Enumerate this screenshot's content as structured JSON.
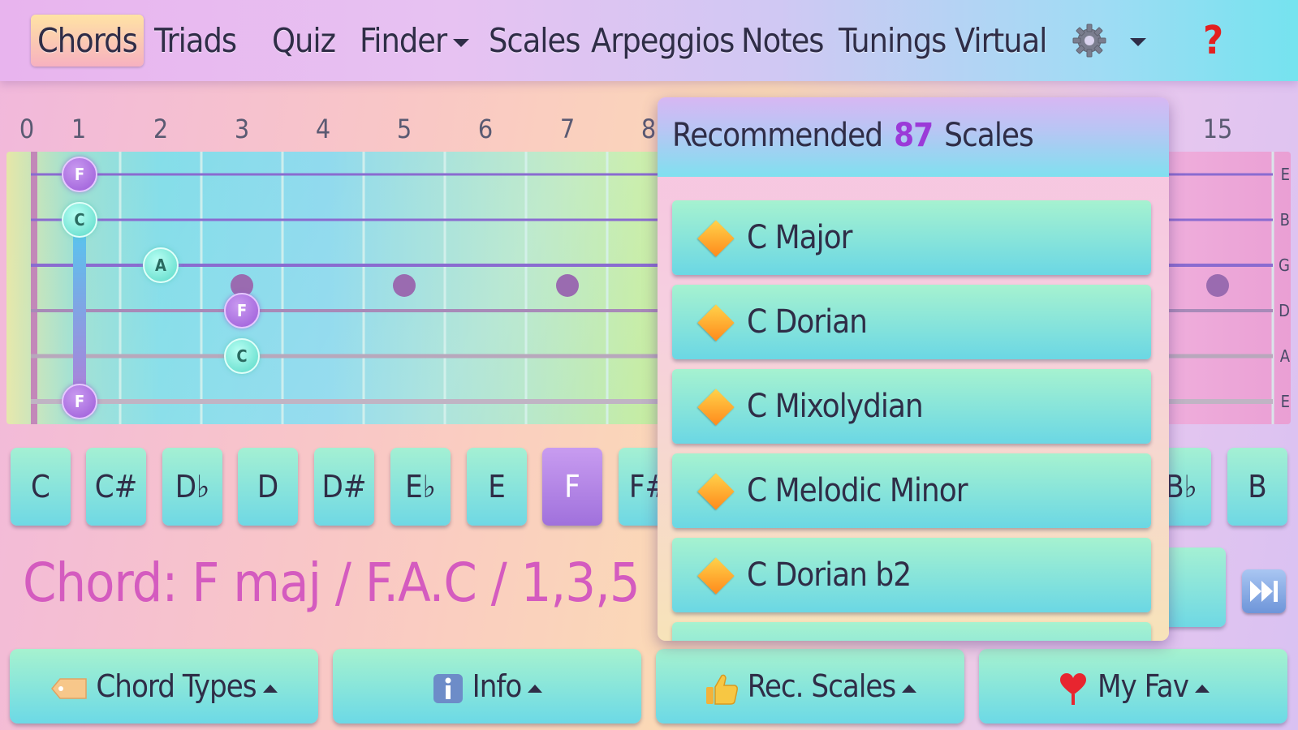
{
  "nav": {
    "items": [
      {
        "label": "Chords",
        "active": true
      },
      {
        "label": "Triads"
      },
      {
        "label": "Quiz"
      },
      {
        "label": "Finder"
      },
      {
        "label": "Scales"
      },
      {
        "label": "Arpeggios"
      },
      {
        "label": "Notes"
      },
      {
        "label": "Tunings"
      },
      {
        "label": "Virtual"
      }
    ],
    "help_label": "?",
    "settings_icon": "gear-icon"
  },
  "fretboard": {
    "fret_numbers": [
      "0",
      "1",
      "2",
      "3",
      "4",
      "5",
      "6",
      "7",
      "8",
      "15"
    ],
    "string_labels": [
      "E",
      "B",
      "G",
      "D",
      "A",
      "E"
    ],
    "notes": [
      {
        "label": "F",
        "string": 1,
        "fret": 1,
        "root": true
      },
      {
        "label": "C",
        "string": 2,
        "fret": 1,
        "root": false
      },
      {
        "label": "A",
        "string": 3,
        "fret": 2,
        "root": false
      },
      {
        "label": "F",
        "string": 4,
        "fret": 3,
        "root": true
      },
      {
        "label": "C",
        "string": 5,
        "fret": 3,
        "root": false
      },
      {
        "label": "F",
        "string": 6,
        "fret": 1,
        "root": true
      }
    ],
    "barre": {
      "fret": 1,
      "from_string": 2,
      "to_string": 6
    }
  },
  "keys": {
    "items": [
      "C",
      "C#",
      "D♭",
      "D",
      "D#",
      "E♭",
      "E",
      "F",
      "F#",
      "B♭",
      "B"
    ],
    "selected": "F"
  },
  "chord_info": "Chord: F maj / F.A.C / 1,3,5",
  "popup": {
    "title": "Recommended",
    "count": "87",
    "suffix": "Scales",
    "scales": [
      "C Major",
      "C Dorian",
      "C Mixolydian",
      "C Melodic Minor",
      "C Dorian b2"
    ]
  },
  "bottom_tabs": [
    {
      "label": "Chord Types",
      "icon": "tag-icon"
    },
    {
      "label": "Info",
      "icon": "info-icon"
    },
    {
      "label": "Rec. Scales",
      "icon": "thumbs-up-icon"
    },
    {
      "label": "My Fav",
      "icon": "heart-icon"
    }
  ],
  "colors": {
    "accent": "#9b3ad8",
    "chord_text": "#d45bbf",
    "key_active": "#a071dc",
    "help": "#e32020"
  }
}
